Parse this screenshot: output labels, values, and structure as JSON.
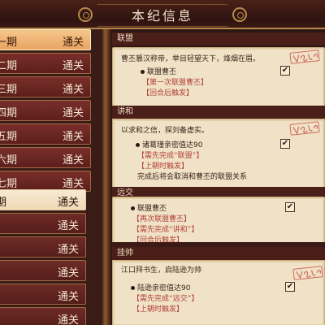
{
  "header": {
    "title": "本纪信息"
  },
  "left_list": {
    "items": [
      {
        "name": "一期",
        "status": "通关"
      },
      {
        "name": "二期",
        "status": "通关"
      },
      {
        "name": "三期",
        "status": "通关"
      },
      {
        "name": "四期",
        "status": "通关"
      },
      {
        "name": "五期",
        "status": "通关"
      },
      {
        "name": "六期",
        "status": "通关"
      },
      {
        "name": "七期",
        "status": "通关"
      },
      {
        "name": "期",
        "status": "通关"
      },
      {
        "name": "",
        "status": "通关"
      },
      {
        "name": "",
        "status": "通关"
      },
      {
        "name": "",
        "status": "通关"
      },
      {
        "name": "",
        "status": "通关"
      },
      {
        "name": "",
        "status": "通关"
      }
    ]
  },
  "sections": [
    {
      "title": "联盟",
      "desc": "曹丕篡汉称帝，举目轻望天下，烽烟在眉。",
      "condition": "联盟曹丕",
      "sub": [
        "【第一次联盟曹丕】",
        "【回合后触发】"
      ],
      "note": "",
      "checked": true
    },
    {
      "title": "讲和",
      "desc": "以求和之信，探刘备虚实。",
      "condition": "诸葛瑾亲密值达90",
      "sub": [
        "【需先完成“联盟”】",
        "【上朝时触发】"
      ],
      "note": "完成后将会取消和曹丕的联盟关系",
      "checked": true
    },
    {
      "title": "远交",
      "desc": "",
      "condition": "联盟曹丕",
      "sub": [
        "【再次联盟曹丕】",
        "【需先完成“讲和”】",
        "【回合后触发】"
      ],
      "note": "",
      "checked": true
    },
    {
      "title": "挂帅",
      "desc": "江口拜书生，启陆逊为帅",
      "condition": "陆逊亲密值达90",
      "sub": [
        "【需先完成“远交”】",
        "【上朝时触发】"
      ],
      "note": "",
      "checked": true
    }
  ],
  "icons": {
    "check": "✔",
    "bullet": "●"
  },
  "colors": {
    "selected_item": "#f0b677",
    "item": "#6a2622",
    "card_bg": "#f0e2c6",
    "accent_red": "#b2413a",
    "frame_gold": "#b78a4a"
  }
}
